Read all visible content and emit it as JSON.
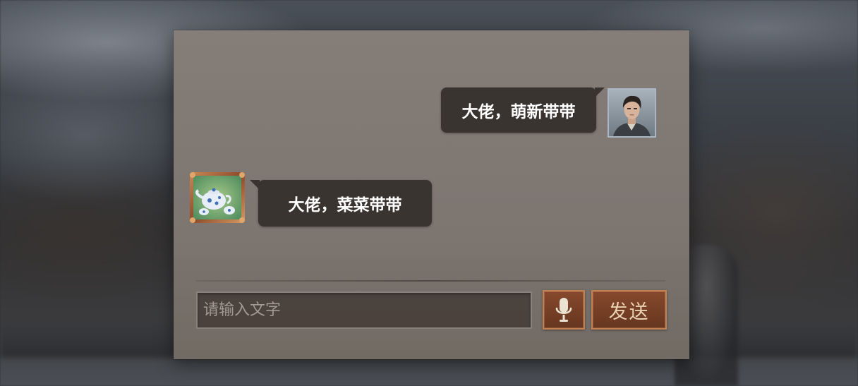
{
  "chat": {
    "messages": [
      {
        "sender": "self",
        "text": "大佬，萌新带带"
      },
      {
        "sender": "other",
        "text": "大佬，菜菜带带"
      }
    ]
  },
  "composer": {
    "placeholder": "请输入文字",
    "value": "",
    "send_label": "发送"
  },
  "icons": {
    "mic": "microphone-icon",
    "self_avatar": "character-portrait",
    "other_avatar": "item-portrait-teapot"
  },
  "colors": {
    "panel": "#807873",
    "bubble": "#3a3431",
    "button": "#7a4128",
    "button_border": "#c98555"
  }
}
